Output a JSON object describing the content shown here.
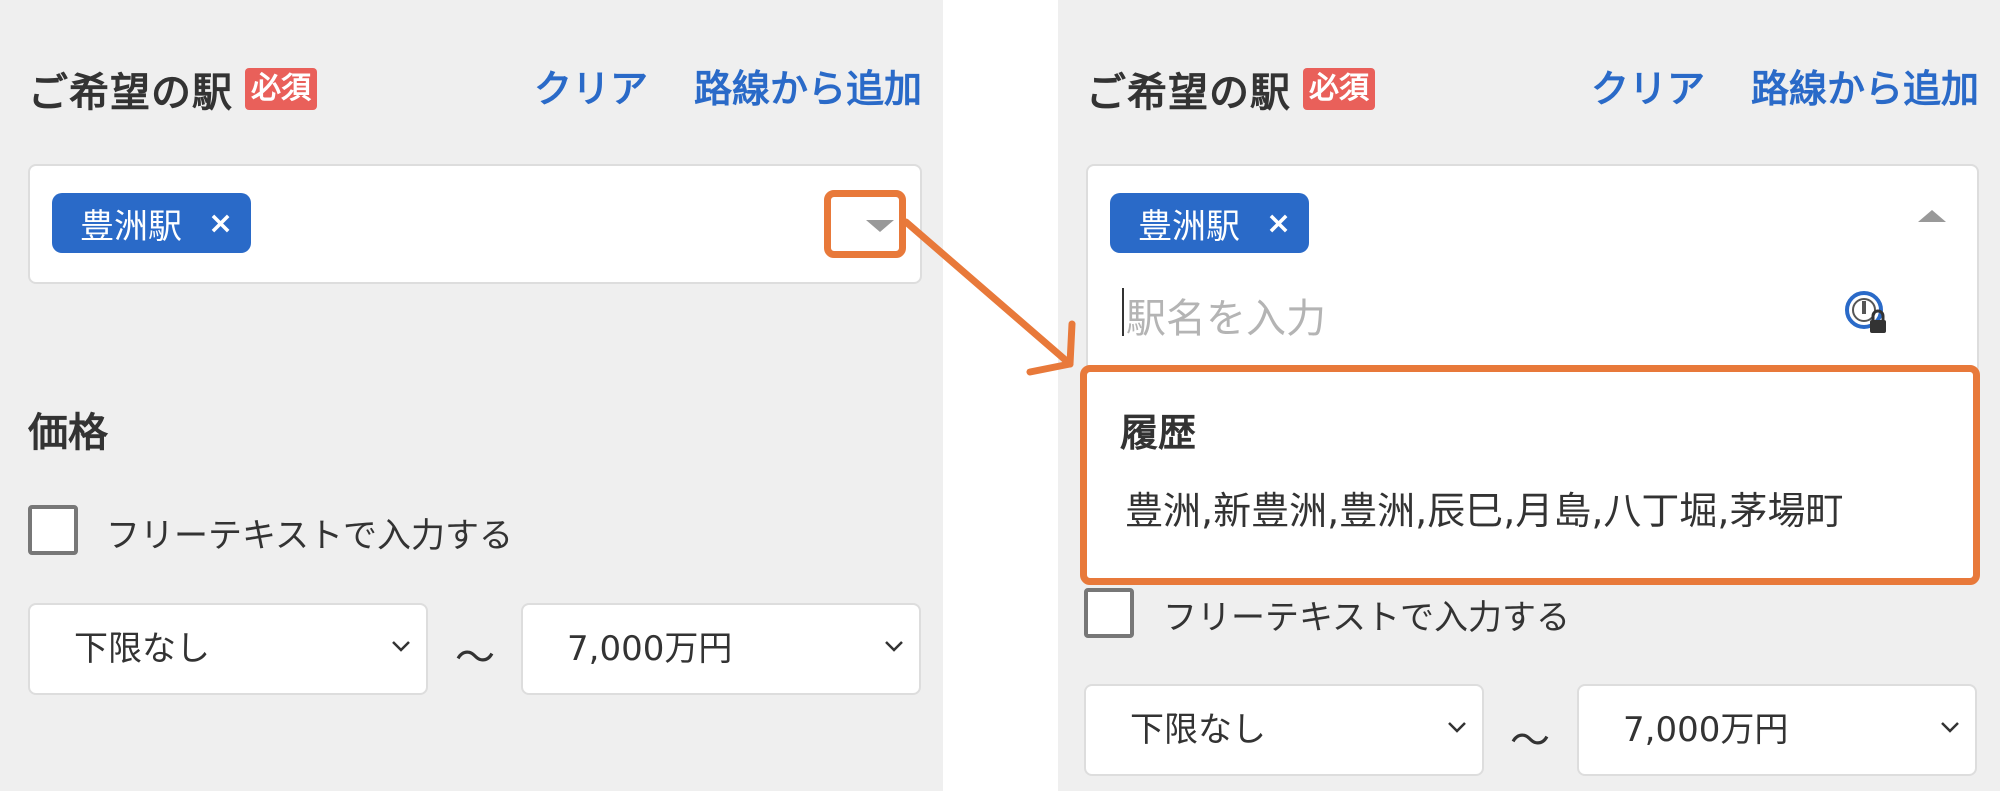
{
  "station_section": {
    "title": "ご希望の駅",
    "required_badge": "必須",
    "clear_link": "クリア",
    "add_by_line_link": "路線から追加",
    "selected_chip": "豊洲駅",
    "chip_remove": "×",
    "input_placeholder": "駅名を入力"
  },
  "history_dropdown": {
    "title": "履歴",
    "items": [
      "豊洲,新豊洲,豊洲,辰巳,月島,八丁堀,茅場町"
    ]
  },
  "price_section": {
    "title": "価格",
    "free_text_checkbox_label": "フリーテキストで入力する",
    "min_value": "下限なし",
    "range_separator": "〜",
    "max_value": "7,000万円"
  },
  "colors": {
    "accent_blue": "#2a6ac8",
    "required_red": "#e9605a",
    "annotation_orange": "#e8793a",
    "panel_bg": "#efefef"
  },
  "icons": [
    "remove-x-icon",
    "dropdown-arrow-icon",
    "password-manager-icon",
    "chevron-down-icon"
  ]
}
